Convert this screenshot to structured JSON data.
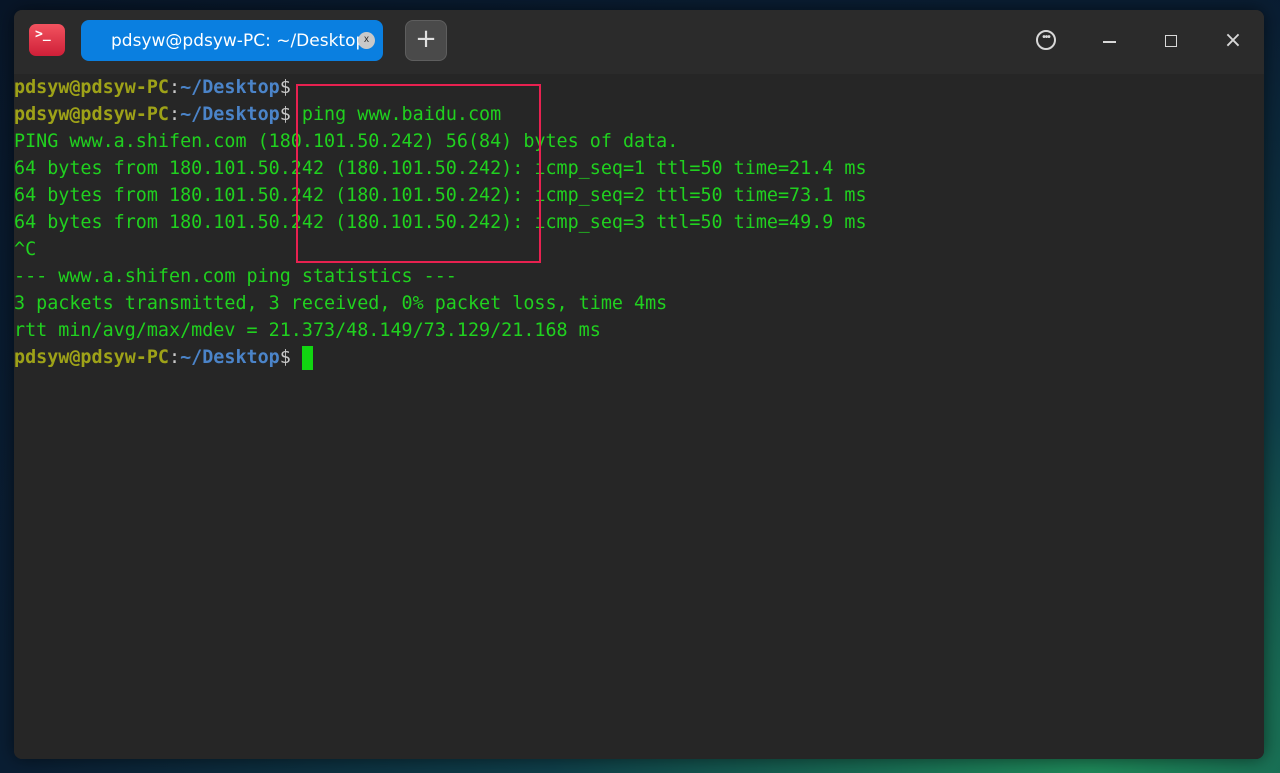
{
  "window": {
    "tab_label": "pdsyw@pdsyw-PC: ~/Desktop",
    "tab_close": "x",
    "new_tab": "+",
    "app_icon_glyph": ">_",
    "close_glyph": "×"
  },
  "prompt": {
    "user": "pdsyw@pdsyw-PC",
    "colon": ":",
    "path": "~/Desktop",
    "dollar": "$"
  },
  "terminal": {
    "command": "ping www.baidu.com",
    "output": [
      "PING www.a.shifen.com (180.101.50.242) 56(84) bytes of data.",
      "64 bytes from 180.101.50.242 (180.101.50.242): icmp_seq=1 ttl=50 time=21.4 ms",
      "64 bytes from 180.101.50.242 (180.101.50.242): icmp_seq=2 ttl=50 time=73.1 ms",
      "64 bytes from 180.101.50.242 (180.101.50.242): icmp_seq=3 ttl=50 time=49.9 ms",
      "^C",
      "--- www.a.shifen.com ping statistics ---",
      "3 packets transmitted, 3 received, 0% packet loss, time 4ms",
      "rtt min/avg/max/mdev = 21.373/48.149/73.129/21.168 ms"
    ]
  },
  "colors": {
    "output_green": "#20d11f",
    "user_olive": "#9ea218",
    "path_blue": "#4b84c9",
    "tab_blue": "#0a7fe0",
    "highlight_red": "#e82150",
    "background": "#262626"
  },
  "icons": {
    "app": "terminal-app-icon",
    "menu": "more-options-icon",
    "minimize": "minimize-icon",
    "maximize": "maximize-icon",
    "close": "close-icon",
    "tab_close": "tab-close-icon",
    "new_tab": "plus-icon"
  }
}
